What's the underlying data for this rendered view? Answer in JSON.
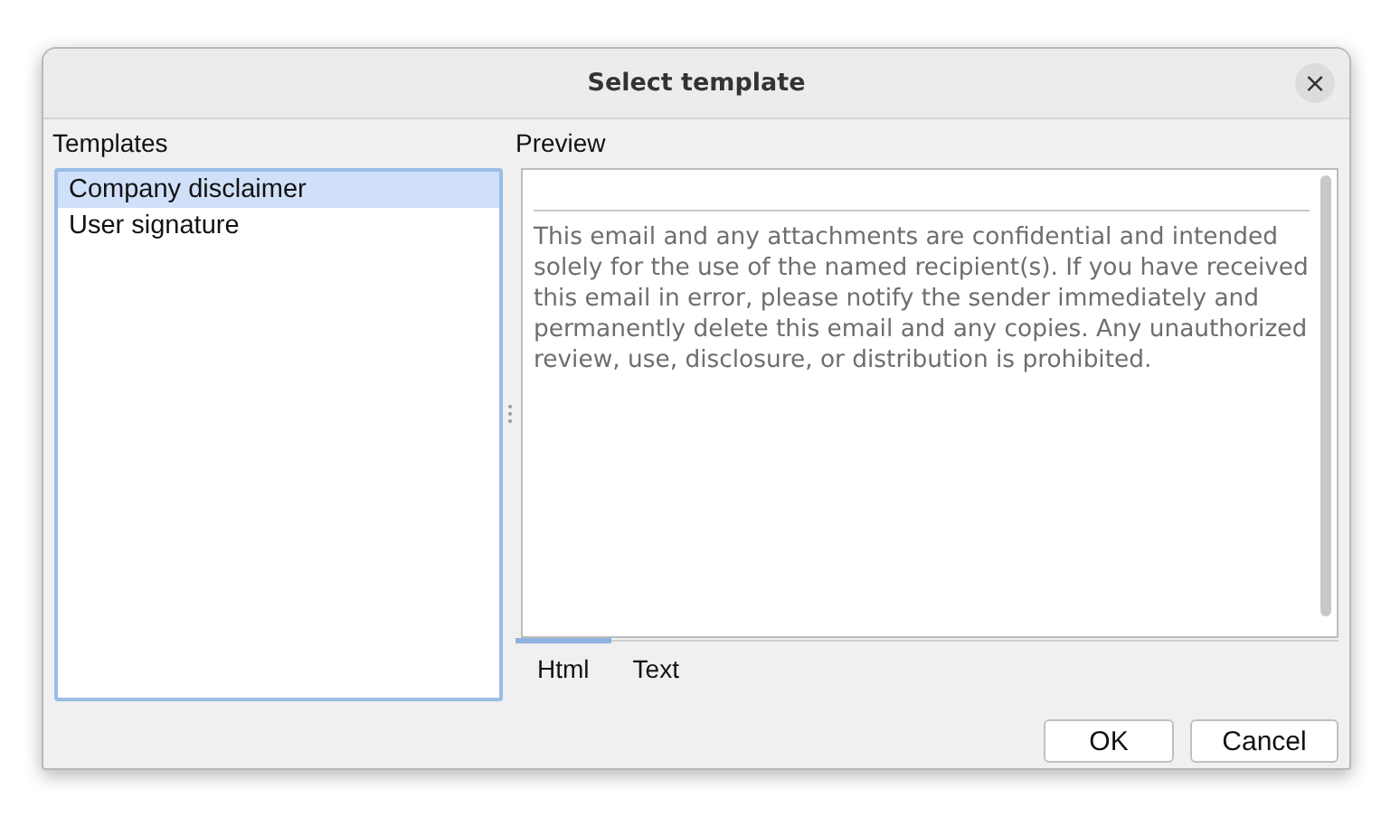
{
  "window": {
    "title": "Select template",
    "close": "×"
  },
  "templates": {
    "label": "Templates",
    "items": [
      {
        "label": "Company disclaimer",
        "selected": true
      },
      {
        "label": "User signature",
        "selected": false
      }
    ]
  },
  "preview": {
    "label": "Preview",
    "body": "This email and any attachments are confidential and intended solely for the use of the named recipient(s). If you have received this email in error, please notify the sender immediately and permanently delete this email and any copies. Any unauthorized review, use, disclosure, or distribution is prohibited."
  },
  "tabs": [
    {
      "label": "Html",
      "selected": true
    },
    {
      "label": "Text",
      "selected": false
    }
  ],
  "buttons": [
    "OK",
    "Cancel"
  ]
}
